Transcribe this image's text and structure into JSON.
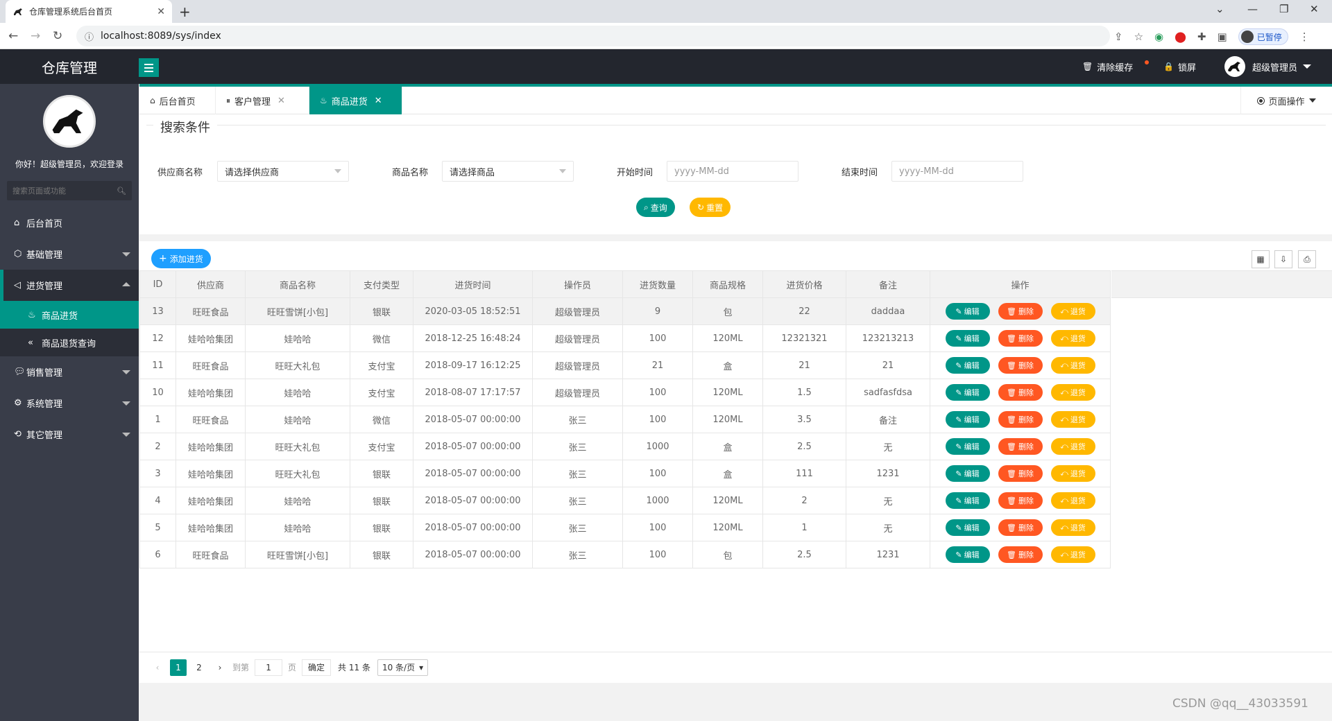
{
  "browser": {
    "tab_title": "仓库管理系统后台首页",
    "tab_close": "✕",
    "new_tab": "+",
    "url": "localhost:8089/sys/index",
    "paused_label": "已暂停"
  },
  "header": {
    "logo": "仓库管理",
    "clear_cache": "清除缓存",
    "lock_screen": "锁屏",
    "user_name": "超级管理员"
  },
  "sidebar": {
    "welcome": "你好！超级管理员，欢迎登录",
    "search_placeholder": "搜索页面或功能",
    "items": [
      {
        "label": "后台首页",
        "icon": "home-icon"
      },
      {
        "label": "基础管理",
        "icon": "cube-icon"
      },
      {
        "label": "进货管理",
        "icon": "speaker-icon"
      },
      {
        "label": "销售管理",
        "icon": "chat-icon"
      },
      {
        "label": "系统管理",
        "icon": "gear-icon"
      },
      {
        "label": "其它管理",
        "icon": "circle-arrow-icon"
      }
    ],
    "subitems": [
      {
        "label": "商品进货",
        "icon": "fire-icon"
      },
      {
        "label": "商品退货查询",
        "icon": "double-chevron-left-icon"
      }
    ]
  },
  "tabs": {
    "items": [
      {
        "label": "后台首页"
      },
      {
        "label": "客户管理"
      },
      {
        "label": "商品进货"
      }
    ],
    "page_ops": "页面操作"
  },
  "search": {
    "legend": "搜索条件",
    "supplier_label": "供应商名称",
    "supplier_value": "请选择供应商",
    "goods_label": "商品名称",
    "goods_value": "请选择商品",
    "start_label": "开始时间",
    "start_placeholder": "yyyy-MM-dd",
    "end_label": "结束时间",
    "end_placeholder": "yyyy-MM-dd",
    "query_btn": "查询",
    "reset_btn": "重置"
  },
  "toolbar": {
    "add_btn": "添加进货"
  },
  "table": {
    "columns": [
      "ID",
      "供应商",
      "商品名称",
      "支付类型",
      "进货时间",
      "操作员",
      "进货数量",
      "商品规格",
      "进货价格",
      "备注",
      "操作"
    ],
    "action_labels": {
      "edit": "编辑",
      "delete": "删除",
      "return": "退货"
    },
    "rows": [
      [
        "13",
        "旺旺食品",
        "旺旺雪饼[小包]",
        "银联",
        "2020-03-05 18:52:51",
        "超级管理员",
        "9",
        "包",
        "22",
        "daddaa"
      ],
      [
        "12",
        "娃哈哈集团",
        "娃哈哈",
        "微信",
        "2018-12-25 16:48:24",
        "超级管理员",
        "100",
        "120ML",
        "12321321",
        "123213213"
      ],
      [
        "11",
        "旺旺食品",
        "旺旺大礼包",
        "支付宝",
        "2018-09-17 16:12:25",
        "超级管理员",
        "21",
        "盒",
        "21",
        "21"
      ],
      [
        "10",
        "娃哈哈集团",
        "娃哈哈",
        "支付宝",
        "2018-08-07 17:17:57",
        "超级管理员",
        "100",
        "120ML",
        "1.5",
        "sadfasfdsa"
      ],
      [
        "1",
        "旺旺食品",
        "娃哈哈",
        "微信",
        "2018-05-07 00:00:00",
        "张三",
        "100",
        "120ML",
        "3.5",
        "备注"
      ],
      [
        "2",
        "娃哈哈集团",
        "旺旺大礼包",
        "支付宝",
        "2018-05-07 00:00:00",
        "张三",
        "1000",
        "盒",
        "2.5",
        "无"
      ],
      [
        "3",
        "娃哈哈集团",
        "旺旺大礼包",
        "银联",
        "2018-05-07 00:00:00",
        "张三",
        "100",
        "盒",
        "111",
        "1231"
      ],
      [
        "4",
        "娃哈哈集团",
        "娃哈哈",
        "银联",
        "2018-05-07 00:00:00",
        "张三",
        "1000",
        "120ML",
        "2",
        "无"
      ],
      [
        "5",
        "娃哈哈集团",
        "娃哈哈",
        "银联",
        "2018-05-07 00:00:00",
        "张三",
        "100",
        "120ML",
        "1",
        "无"
      ],
      [
        "6",
        "旺旺食品",
        "旺旺雪饼[小包]",
        "银联",
        "2018-05-07 00:00:00",
        "张三",
        "100",
        "包",
        "2.5",
        "1231"
      ]
    ]
  },
  "pager": {
    "page1": "1",
    "page2": "2",
    "goto": "到第",
    "goto_value": "1",
    "page_word": "页",
    "confirm": "确定",
    "total": "共 11 条",
    "per_page": "10 条/页"
  },
  "watermark": "CSDN @qq__43033591",
  "colors": {
    "accent": "#009688",
    "danger": "#ff5722",
    "warn": "#ffb800",
    "primary": "#1e9fff"
  }
}
